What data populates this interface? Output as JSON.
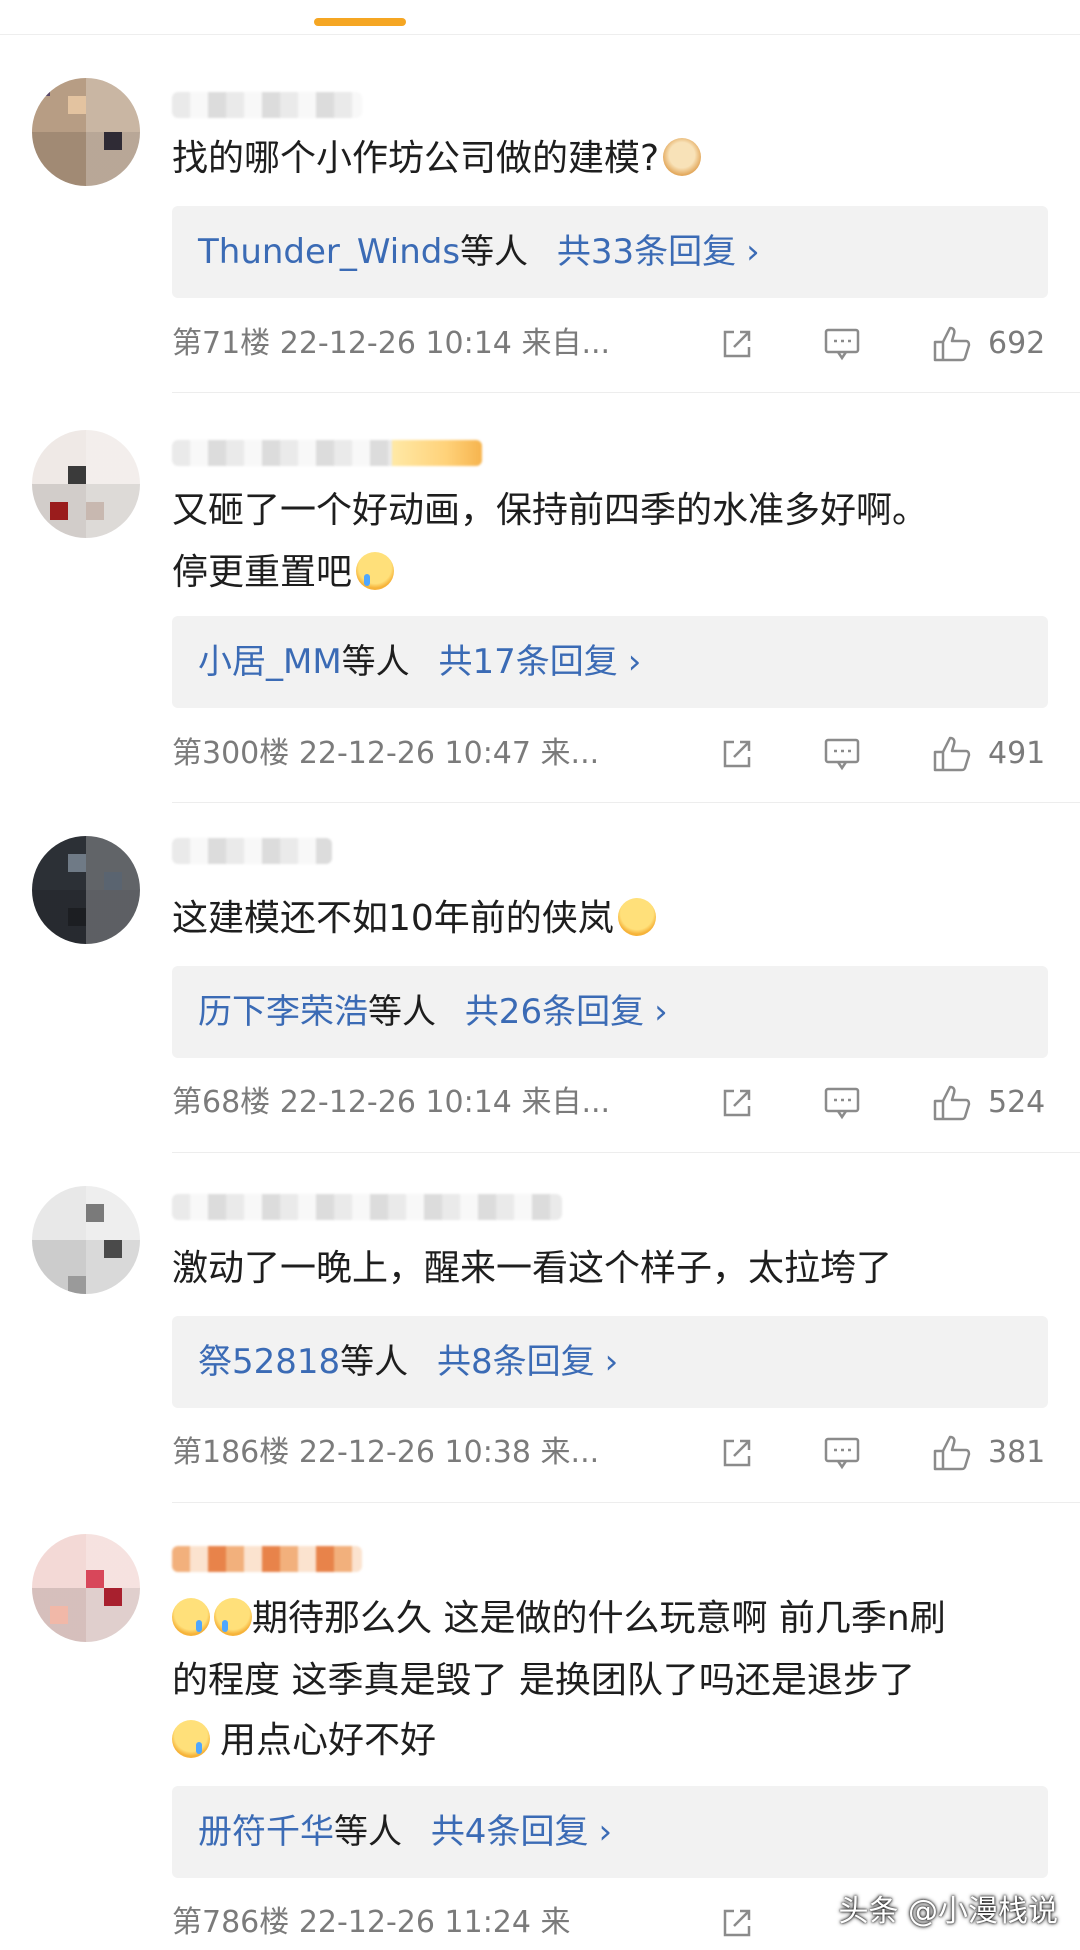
{
  "comments": [
    {
      "text": "找的哪个小作坊公司做的建模?",
      "reply_users": "Thunder_Winds",
      "reply_mid": "等人",
      "reply_count": "共33条回复",
      "floor": "第71楼",
      "timestamp": "22-12-26 10:14",
      "source": "来自...",
      "likes": "692"
    },
    {
      "text_line1": "又砸了一个好动画，保持前四季的水准多好啊。",
      "text_line2": "停更重置吧",
      "reply_users": "小居_MM",
      "reply_mid": "等人",
      "reply_count": "共17条回复",
      "floor": "第300楼",
      "timestamp": "22-12-26 10:47",
      "source": "来...",
      "likes": "491"
    },
    {
      "text": "这建模还不如10年前的侠岚",
      "reply_users": "历下李荣浩",
      "reply_mid": "等人",
      "reply_count": "共26条回复",
      "floor": "第68楼",
      "timestamp": "22-12-26 10:14",
      "source": "来自...",
      "likes": "524"
    },
    {
      "text": "激动了一晚上，醒来一看这个样子，太拉垮了",
      "reply_users": "祭52818",
      "reply_mid": "等人",
      "reply_count": "共8条回复",
      "floor": "第186楼",
      "timestamp": "22-12-26 10:38",
      "source": "来...",
      "likes": "381"
    },
    {
      "text_line1": "期待那么久 这是做的什么玩意啊 前几季n刷",
      "text_line2": "的程度 这季真是毁了 是换团队了吗还是退步了",
      "text_line3": "用点心好不好",
      "reply_users": "册符千华",
      "reply_mid": "等人",
      "reply_count": "共4条回复",
      "floor": "第786楼",
      "timestamp": "22-12-26 11:24",
      "source": "来"
    }
  ],
  "watermark": "头条 @小漫栈说",
  "colors": {
    "accent": "#f5a623",
    "link": "#3b6bb5",
    "meta": "#7b7b7b",
    "reply_bg": "#f2f2f2"
  }
}
